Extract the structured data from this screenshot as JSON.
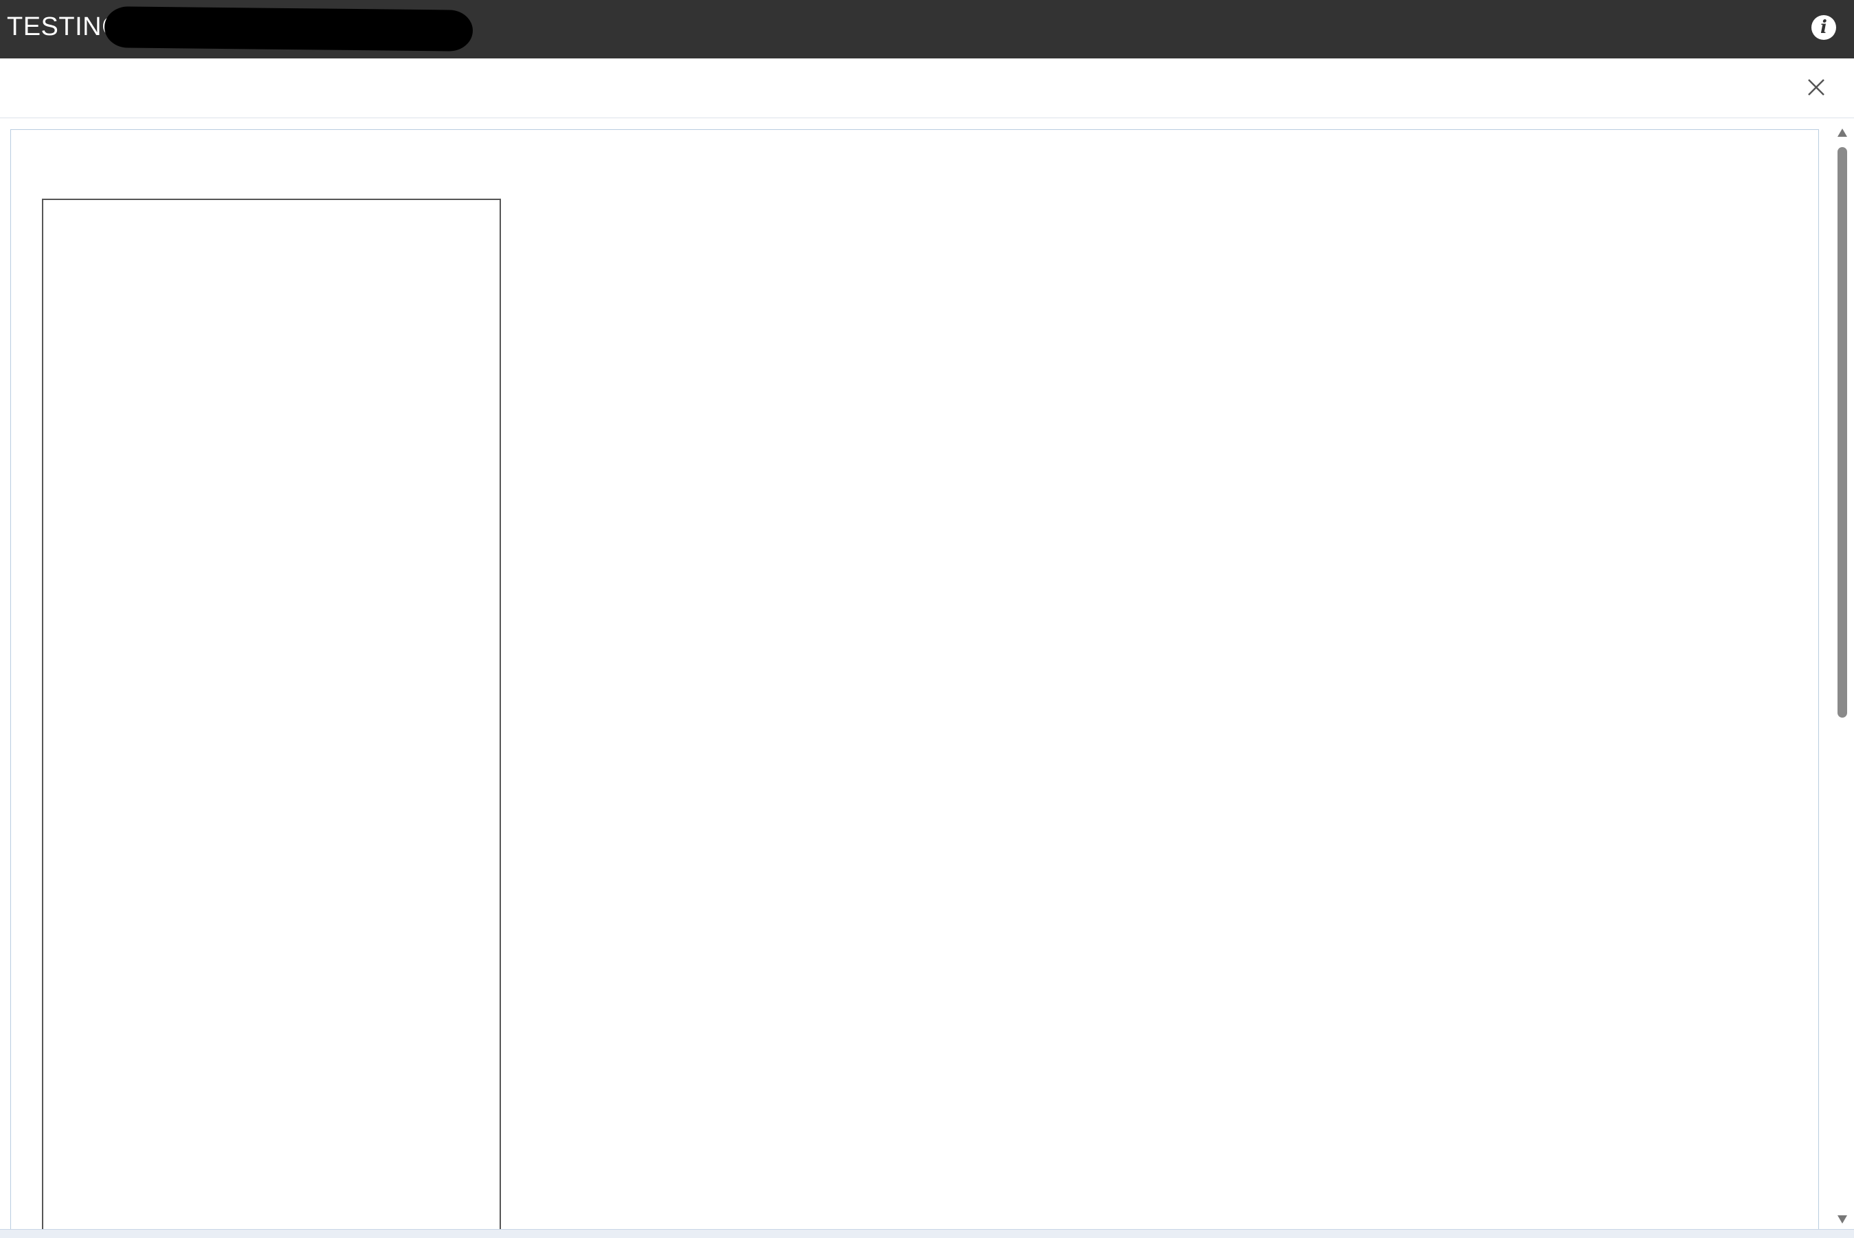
{
  "header": {
    "title": "TESTING",
    "title_redacted": true,
    "info_icon": "info-icon",
    "background_color": "#333333"
  },
  "dialog": {
    "close_icon": "close-icon"
  },
  "colors": {
    "frame_border": "#b9cde0",
    "panel_border": "#555555",
    "scroll_thumb": "#8a8a8a"
  }
}
